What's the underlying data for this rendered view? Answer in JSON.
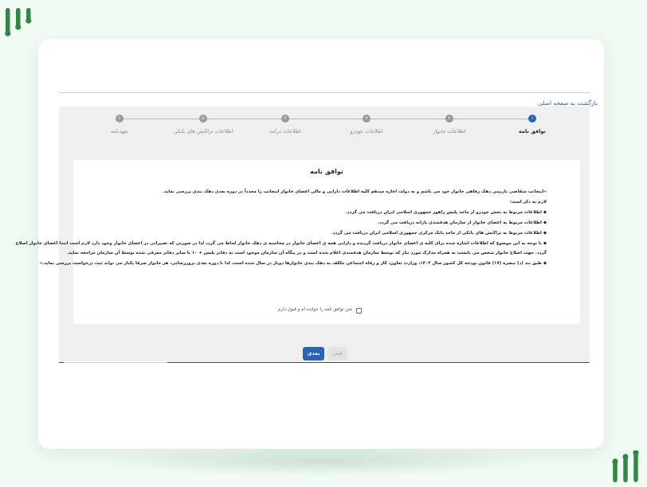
{
  "back_link": "بازگشت به صفحه اصلی",
  "steps": [
    {
      "number": "۱",
      "label": "توافق نامه",
      "active": true
    },
    {
      "number": "۲",
      "label": "اطلاعات خانوار",
      "active": false
    },
    {
      "number": "۳",
      "label": "اطلاعات خودرو",
      "active": false
    },
    {
      "number": "۴",
      "label": "اطلاعات درآمد",
      "active": false
    },
    {
      "number": "۵",
      "label": "اطلاعات تراکنش های بانکی",
      "active": false
    },
    {
      "number": "۶",
      "label": "تعهدنامه",
      "active": false
    }
  ],
  "agreement": {
    "title": "توافق نامه",
    "lines": [
      "«اینجانب متقاضی بازبینی دهک رفاهی خانوار خود می باشم و به دولت اجازه میدهم کلیه اطلاعات دارایی و مالی اعضای خانوار اینجانب را مجدداً در دوره بعدی دهک بندی بررسی نماید.",
      "لازم به ذکر است:",
      "◆ اطلاعات مربوط به بخش خودرو از ماخذ پلیس راهور جمهوری اسلامی ایران دریافت می گردد.",
      "◆ اطلاعات مربوط به اعضای خانوار از سازمان هدفمندی یارانه دریافت می گردد.",
      "◆ اطلاعات مربوط به تراکنش های بانکی از ماخذ بانک مرکزی جمهوری اسلامی ایران دریافت می گردد.",
      "◆ با توجه به این موضوع که اطلاعات اشاره شده برای کلیه ی اعضای خانوار دریافت گردیده و دارایی همه ی اعضای خانوار در محاسبه ی دهک خانوار لحاظ می گردد لذا در صورتی که تغییراتی در اعضای خانوار وجود دارد لازم است ابتدا اعضای خانوار اصلاح",
      "گردد. جهت اصلاح خانوار شخص می بایست به همراه مدارک مورد نیاز که توسط سازمان هدفمندی اعلام شده است و در پیگاه آن سازمان موجود است به دفاتر پلیس + ۱۰ یا سایر دفاتر معرفی شده توسط آن سازمان مراجعه نماید.",
      "◆ طبق بند (د) تبصره (۱۷) قانون بودجه کل کشور سال ۱۴۰۳، وزارت تعاون، کار و رفاه اجتماعی مکلف به دهک بندی خانوارها دوبار در سال شده است، لذا تا دوره بعدی بروزرسانی، هر خانوار صرفا یکبار می تواند ثبت درخواست بررسی نماید.»"
    ],
    "consent_label": "متن توافق نامه را خوانده ام و قبول دارم"
  },
  "buttons": {
    "next": "بعدی",
    "prev": "قبلی"
  },
  "colors": {
    "accent": "#2a64b8",
    "background": "#f1fbf4",
    "logo": "#2e8a3e"
  }
}
